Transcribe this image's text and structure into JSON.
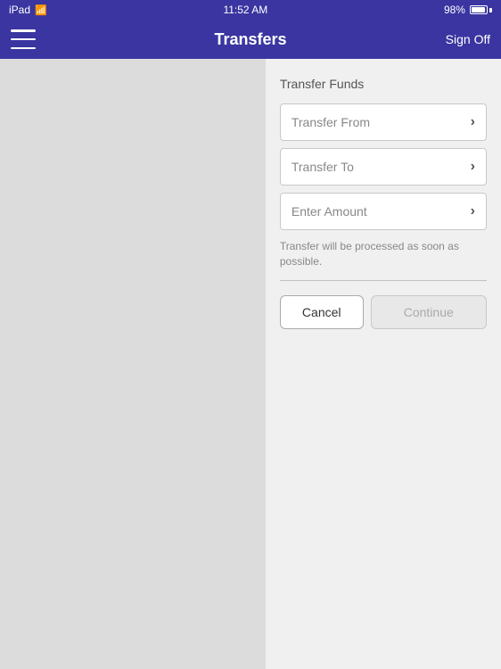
{
  "status_bar": {
    "device": "iPad",
    "wifi_label": "wifi",
    "time": "11:52 AM",
    "battery_percent": "98%"
  },
  "nav_bar": {
    "title": "Transfers",
    "sign_off_label": "Sign Off",
    "menu_icon": "menu-icon"
  },
  "form": {
    "section_title": "Transfer Funds",
    "transfer_from_label": "Transfer From",
    "transfer_to_label": "Transfer To",
    "enter_amount_label": "Enter Amount",
    "info_text": "Transfer will be processed as soon as possible.",
    "cancel_label": "Cancel",
    "continue_label": "Continue"
  }
}
